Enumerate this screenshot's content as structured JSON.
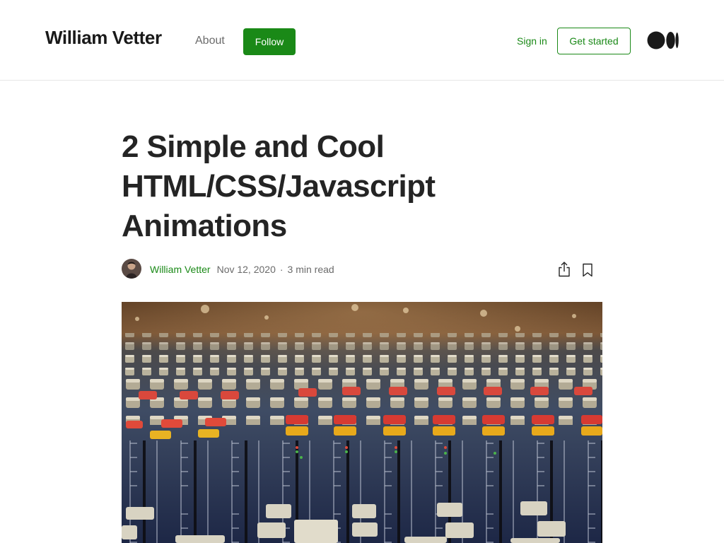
{
  "header": {
    "site_title": "William Vetter",
    "about_label": "About",
    "follow_label": "Follow",
    "signin_label": "Sign in",
    "get_started_label": "Get started",
    "logo_icon": "medium-logo-icon"
  },
  "article": {
    "title": "2 Simple and Cool HTML/CSS/Javascript Animations",
    "author": "William Vetter",
    "date": "Nov 12, 2020",
    "separator": "·",
    "read_time": "3 min read",
    "actions": {
      "share_icon": "share-icon",
      "bookmark_icon": "bookmark-icon"
    },
    "hero_image": "audio-mixing-console-photo"
  },
  "colors": {
    "brand_green": "#1a8917",
    "text_primary": "#242424",
    "text_secondary": "#6b6b6b",
    "divider": "#e6e6e6"
  }
}
